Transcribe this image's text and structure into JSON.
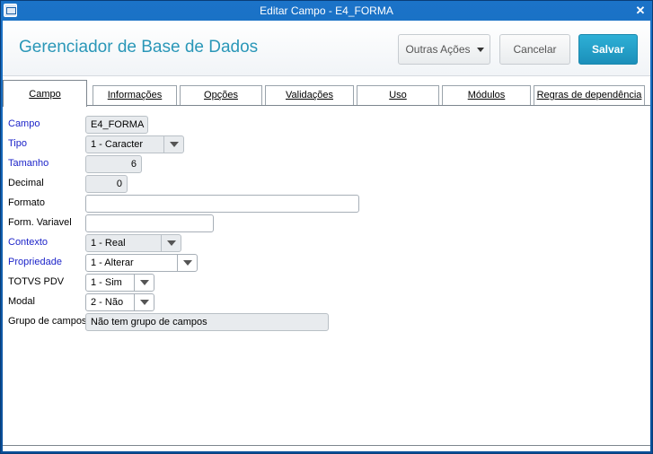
{
  "window": {
    "title": "Editar Campo - E4_FORMA",
    "close_glyph": "✕"
  },
  "header": {
    "app_title": "Gerenciador de Base de Dados",
    "more_actions_label": "Outras Ações",
    "cancel_label": "Cancelar",
    "save_label": "Salvar",
    "accent_color": "#2a97b8"
  },
  "tabs": [
    {
      "label": "Campo",
      "active": true
    },
    {
      "label": "Informações"
    },
    {
      "label": "Opções"
    },
    {
      "label": "Validações"
    },
    {
      "label": "Uso"
    },
    {
      "label": "Módulos"
    },
    {
      "label": "Regras de dependência"
    }
  ],
  "form": {
    "campo": {
      "label": "Campo",
      "value": "E4_FORMA"
    },
    "tipo": {
      "label": "Tipo",
      "value": "1 - Caracter"
    },
    "tamanho": {
      "label": "Tamanho",
      "value": "6"
    },
    "decimal": {
      "label": "Decimal",
      "value": "0"
    },
    "formato": {
      "label": "Formato",
      "value": ""
    },
    "form_variavel": {
      "label": "Form. Variavel",
      "value": ""
    },
    "contexto": {
      "label": "Contexto",
      "value": "1 - Real"
    },
    "propriedade": {
      "label": "Propriedade",
      "value": "1 - Alterar"
    },
    "totvs_pdv": {
      "label": "TOTVS PDV",
      "value": "1 - Sim"
    },
    "modal": {
      "label": "Modal",
      "value": "2 - Não"
    },
    "grupo_campos": {
      "label": "Grupo de campos",
      "value": "Não tem grupo de campos"
    }
  },
  "colors": {
    "required_label": "#1d24c9",
    "save_button": "#1b8fba",
    "titlebar": "#1b73c8"
  }
}
